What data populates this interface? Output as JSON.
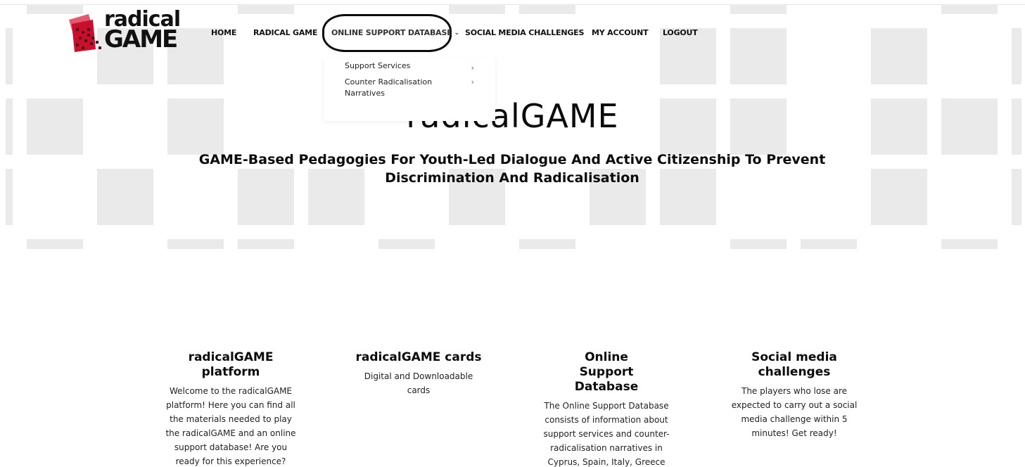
{
  "logo": {
    "line1": "radical",
    "line2": "GAME"
  },
  "nav": {
    "items": [
      {
        "label": "HOME"
      },
      {
        "label": "RADICAL GAME"
      },
      {
        "label": "ONLINE SUPPORT DATABASE"
      },
      {
        "label": "SOCIAL MEDIA CHALLENGES"
      },
      {
        "label": "MY ACCOUNT"
      },
      {
        "label": "LOGOUT"
      }
    ],
    "dropdown": [
      {
        "label": "Support Services",
        "arrow": "›"
      },
      {
        "label": "Counter Radicalisation Narratives",
        "arrow": "›"
      }
    ]
  },
  "hero": {
    "title": "radicalGAME",
    "subtitle": "GAME-Based Pedagogies For Youth-Led Dialogue And Active Citizenship To Prevent Discrimination And Radicalisation"
  },
  "features": [
    {
      "title": "radicalGAME platform",
      "text": "Welcome to the radicalGAME platform! Here you can find all the materials needed to play the radicalGAME and an online support database! Are you ready for this experience?"
    },
    {
      "title": "radicalGAME cards",
      "text": "Digital and Downloadable cards"
    },
    {
      "title": "Online Support Database",
      "text": "The Online Support Database consists of information about support services and counter-radicalisation narratives in Cyprus, Spain, Italy, Greece and Germany."
    },
    {
      "title": "Social media challenges",
      "text": "The players who lose are expected to carry out a social media challenge within 5 minutes! Get ready!"
    }
  ],
  "colors": {
    "text": "#0b0b0b",
    "pattern": "#eaeaea",
    "logo_red": "#c8102e"
  },
  "icons": {
    "dropdown_chevron": "chevron-down-icon",
    "submenu_arrow": "chevron-right-icon"
  }
}
